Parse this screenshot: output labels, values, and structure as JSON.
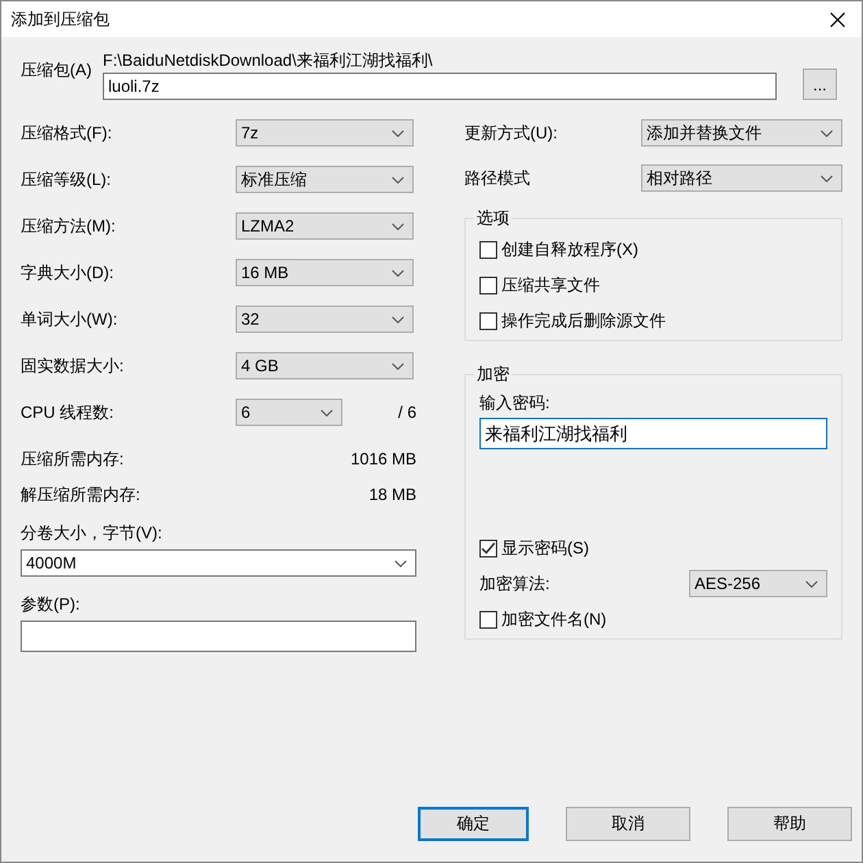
{
  "window": {
    "title": "添加到压缩包"
  },
  "archive": {
    "label": "压缩包(A)",
    "path": "F:\\BaiduNetdiskDownload\\来福利江湖找福利\\",
    "value": "luoli.7z",
    "browse_button": "..."
  },
  "left_fields": [
    {
      "kind": "combo",
      "label": "压缩格式(F):",
      "value": "7z"
    },
    {
      "kind": "combo",
      "label": "压缩等级(L):",
      "value": "标准压缩"
    },
    {
      "kind": "combo",
      "label": "压缩方法(M):",
      "value": "LZMA2"
    },
    {
      "kind": "combo",
      "label": "字典大小(D):",
      "value": "16 MB"
    },
    {
      "kind": "combo",
      "label": "单词大小(W):",
      "value": "32"
    },
    {
      "kind": "combo",
      "label": "固实数据大小:",
      "value": "4 GB"
    },
    {
      "kind": "threads",
      "label": "CPU 线程数:",
      "value": "6",
      "suffix": "/ 6"
    },
    {
      "kind": "info",
      "label": "压缩所需内存:",
      "value": "1016 MB"
    },
    {
      "kind": "info",
      "label": "解压缩所需内存:",
      "value": "18 MB"
    }
  ],
  "volume": {
    "label": "分卷大小，字节(V):",
    "value": "4000M"
  },
  "parameters": {
    "label": "参数(P):"
  },
  "right_fields": [
    {
      "label": "更新方式(U):",
      "value": "添加并替换文件"
    },
    {
      "label": "路径模式",
      "value": "相对路径"
    }
  ],
  "options": {
    "title": "选项",
    "items": [
      {
        "label": "创建自释放程序(X)",
        "checked": false
      },
      {
        "label": "压缩共享文件",
        "checked": false
      },
      {
        "label": "操作完成后删除源文件",
        "checked": false
      }
    ]
  },
  "encryption": {
    "title": "加密",
    "password_label": "输入密码:",
    "password": "来福利江湖找福利",
    "show_password": {
      "label": "显示密码(S)",
      "checked": true
    },
    "method_label": "加密算法:",
    "method": "AES-256",
    "encrypt_names": {
      "label": "加密文件名(N)",
      "checked": false
    }
  },
  "buttons": [
    {
      "label": "确定",
      "default": true
    },
    {
      "label": "取消",
      "default": false
    },
    {
      "label": "帮助",
      "default": false
    }
  ]
}
